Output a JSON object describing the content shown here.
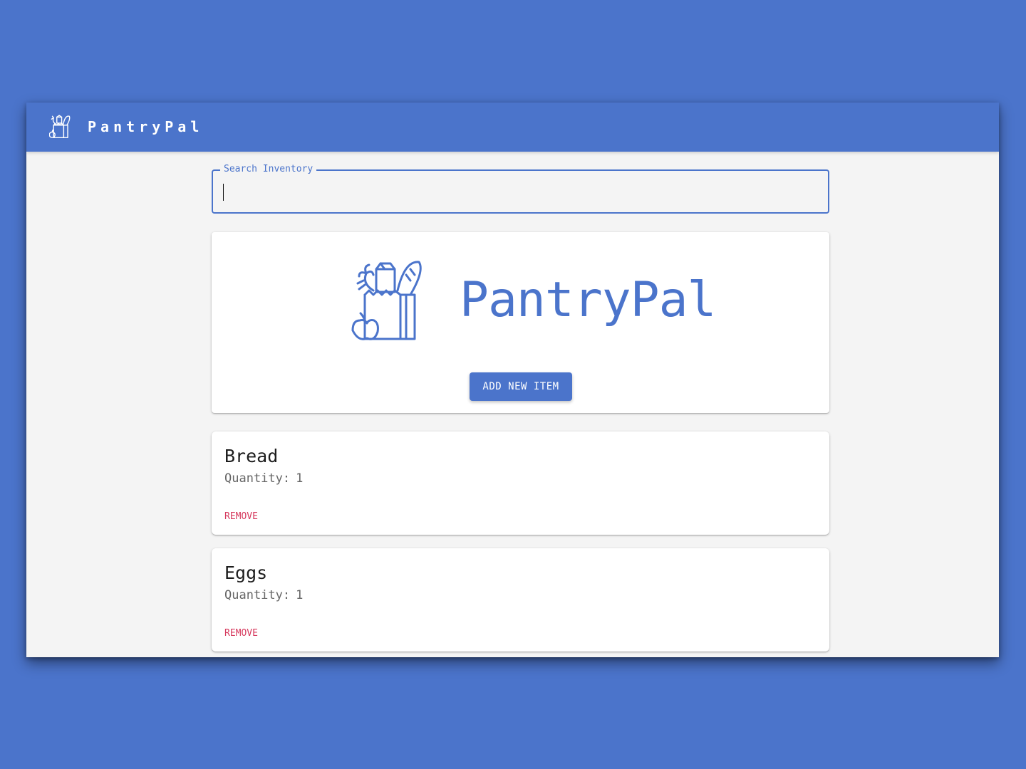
{
  "app": {
    "name": "PantryPal"
  },
  "search": {
    "label": "Search Inventory",
    "value": ""
  },
  "hero": {
    "title": "PantryPal",
    "add_button_label": "ADD NEW ITEM"
  },
  "items": [
    {
      "name": "Bread",
      "quantity_label": "Quantity:",
      "quantity": "1",
      "remove_label": "REMOVE"
    },
    {
      "name": "Eggs",
      "quantity_label": "Quantity:",
      "quantity": "1",
      "remove_label": "REMOVE"
    }
  ],
  "colors": {
    "primary": "#4b74cb",
    "background": "#f4f4f4",
    "danger": "#d63a5e"
  },
  "icons": {
    "logo": "grocery-bag-icon"
  }
}
